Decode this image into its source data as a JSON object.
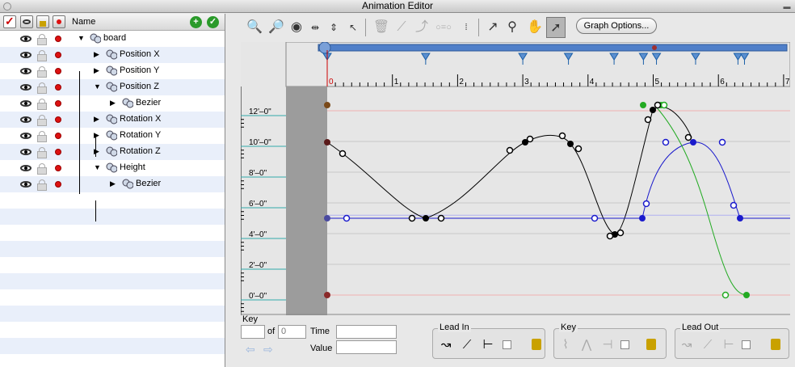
{
  "window": {
    "title": "Animation Editor"
  },
  "left_panel": {
    "column_name": "Name",
    "add_symbol": "+",
    "check_symbol": "✓",
    "back_symbol": "«",
    "rows": [
      {
        "label": "board",
        "indent": 0,
        "expanded": true
      },
      {
        "label": "Position X",
        "indent": 1,
        "expanded": false
      },
      {
        "label": "Position Y",
        "indent": 1,
        "expanded": false
      },
      {
        "label": "Position Z",
        "indent": 1,
        "expanded": true
      },
      {
        "label": "Bezier",
        "indent": 2,
        "expanded": false
      },
      {
        "label": "Rotation X",
        "indent": 1,
        "expanded": false
      },
      {
        "label": "Rotation Y",
        "indent": 1,
        "expanded": false
      },
      {
        "label": "Rotation Z",
        "indent": 1,
        "expanded": false
      },
      {
        "label": "Height",
        "indent": 1,
        "expanded": true
      },
      {
        "label": "Bezier",
        "indent": 2,
        "expanded": false
      }
    ]
  },
  "toolbar": {
    "graph_options": "Graph Options..."
  },
  "timeline": {
    "ticks": [
      "0",
      "1",
      "2",
      "3",
      "4",
      "5",
      "6",
      "7"
    ],
    "y_labels": [
      "12'–0\"",
      "10'–0\"",
      "8'–0\"",
      "6'–0\"",
      "4'–0\"",
      "2'–0\"",
      "0'–0\""
    ]
  },
  "key_panel": {
    "title": "Key",
    "of_label": "of",
    "of_value": "0",
    "time_label": "Time",
    "value_label": "Value",
    "key_index": "",
    "time_value": "",
    "value_value": ""
  },
  "groups": {
    "lead_in": "Lead In",
    "key": "Key",
    "lead_out": "Lead Out"
  },
  "colors": {
    "black_curve": "#000000",
    "blue_curve": "#1a1acc",
    "green_curve": "#22aa22",
    "selection": "#4f7fc9"
  }
}
